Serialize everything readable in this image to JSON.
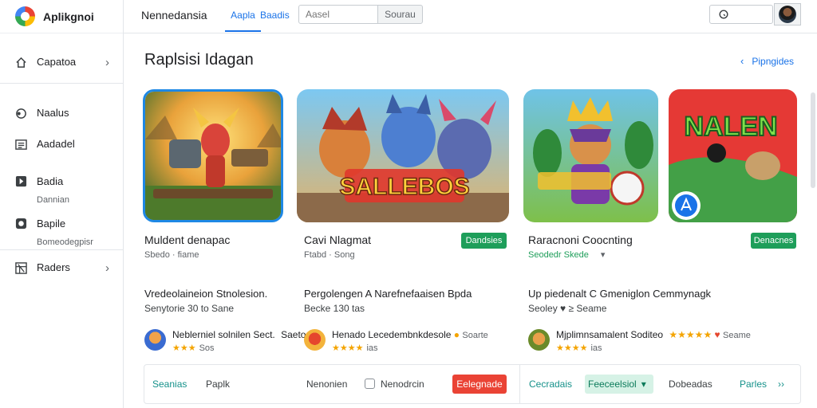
{
  "app": {
    "name": "Aplikgnoi"
  },
  "sidebar": {
    "items": [
      {
        "label": "Capatoa",
        "icon": "home-icon"
      },
      {
        "label": "Naalus",
        "icon": "gamepad-icon"
      },
      {
        "label": "Aadadel",
        "icon": "list-icon"
      },
      {
        "label": "Badia",
        "sub": "Dannian",
        "icon": "play-book-icon"
      },
      {
        "label": "Bapile",
        "sub": "Bomeodegpisr",
        "icon": "circle-icon"
      },
      {
        "label": "Raders",
        "icon": "grid-icon"
      }
    ]
  },
  "header": {
    "title": "Nennedansia",
    "tabs": [
      "Aapla",
      "Baadis"
    ],
    "search_placeholder": "Aasel",
    "search_button": "Sourau"
  },
  "page": {
    "title": "Raplsisi Idagan",
    "link": "Pipngides"
  },
  "cards": [
    {
      "title": "Muldent denapac",
      "sub": "Sbedo · fiame",
      "desc": "Vredeolaineion Stnolesion.",
      "desc2": "Senytorie  30 to Sane",
      "review": {
        "text": "Neblerniel solnilen Sect.",
        "extra": "Saeto",
        "stars": "★★★",
        "count": "Sos"
      }
    },
    {
      "title": "Cavi Nlagmat",
      "sub": "Ftabd · Song",
      "button": "Dandsies",
      "desc": "Pergolengen A Narefnefaaisen Bpda",
      "desc2": "Becke 130 tas",
      "review": {
        "text": "Henado Lecedembnkdesole",
        "extra": "Soarte",
        "stars": "★★★★",
        "count": "ias"
      }
    },
    {
      "title": "Raracnoni Coocnting",
      "sub": "Seodedr Skede",
      "button": "Denacnes",
      "desc": "Up piedenalt C Gmeniglon Cemmynagk",
      "desc2": "Seoley  ♥ ≥ Seame",
      "review": {
        "text": "Mjplimnsamalent Soditeo",
        "stars": "★★★★",
        "count": "ias",
        "badge_stars": "★★★★★",
        "extra": "Seame"
      }
    }
  ],
  "bottom": {
    "left_link": "Seanias",
    "left_label": "Paplk",
    "mid_label": "Nenonien",
    "check_label": "Nenodrcin",
    "red_button": "Eelegnade",
    "green_label": "Cecradais",
    "select_value": "Feeceelsiol",
    "gray_label": "Dobeadas",
    "teal_link": "Parles",
    "arrow": "››"
  },
  "colors": {
    "accent": "#1a73e8",
    "green_button": "#1e9e5a",
    "red_button": "#ea4335",
    "teal": "#15918a",
    "star": "#f4a400"
  }
}
